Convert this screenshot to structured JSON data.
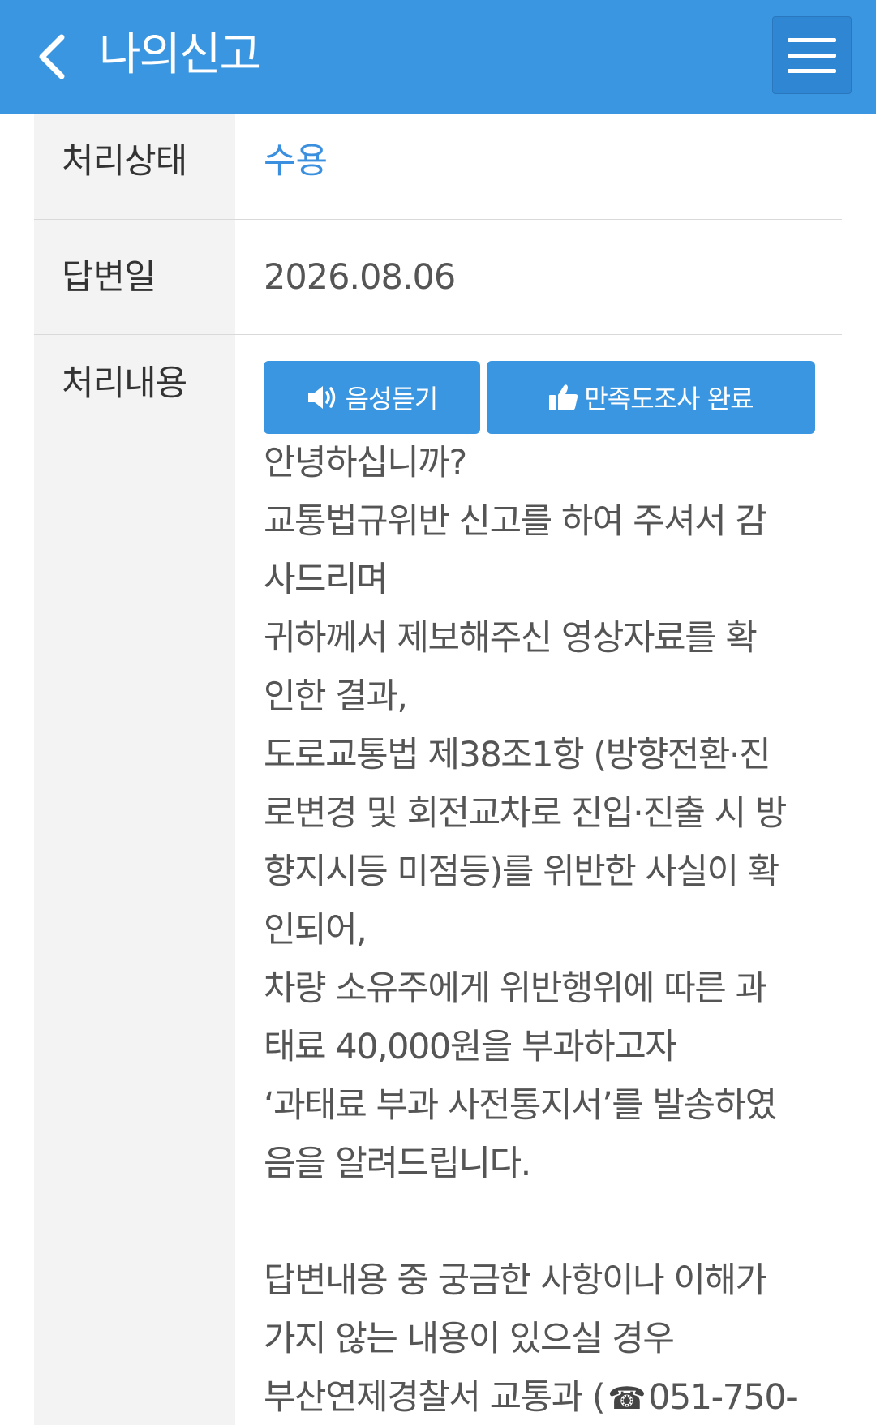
{
  "header": {
    "title": "나의신고",
    "back_icon": "chevron-left-icon",
    "menu_icon": "hamburger-menu-icon",
    "bg_color": "#3a96e0"
  },
  "detail": {
    "status_label": "처리상태",
    "status_value": "수용",
    "status_color": "#3a8fde",
    "answer_date_label": "답변일",
    "answer_date_value": "2026.08.06",
    "content_label": "처리내용",
    "buttons": {
      "voice_label": "음성듣기",
      "voice_icon": "speaker-icon",
      "survey_label": "만족도조사 완료",
      "survey_icon": "thumbs-up-icon"
    },
    "content_lines": [
      "안녕하십니까?",
      "교통법규위반 신고를 하여 주셔서 감",
      "사드리며",
      "귀하께서 제보해주신 영상자료를 확",
      "인한 결과,",
      "도로교통법 제38조1항 (방향전환·진",
      "로변경 및 회전교차로 진입·진출 시 방",
      "향지시등 미점등)를 위반한 사실이 확",
      "인되어,",
      "차량 소유주에게 위반행위에 따른 과",
      "태료 40,000원을 부과하고자",
      "‘과태료 부과 사전통지서’를 발송하였",
      "음을 알려드립니다.",
      "",
      "답변내용 중 궁금한 사항이나 이해가",
      "가지 않는 내용이 있으실 경우"
    ],
    "last_line_prefix": "부산연제경찰서 교통과 (",
    "phone_icon": "telephone-icon",
    "last_line_phone": "051-750-"
  }
}
